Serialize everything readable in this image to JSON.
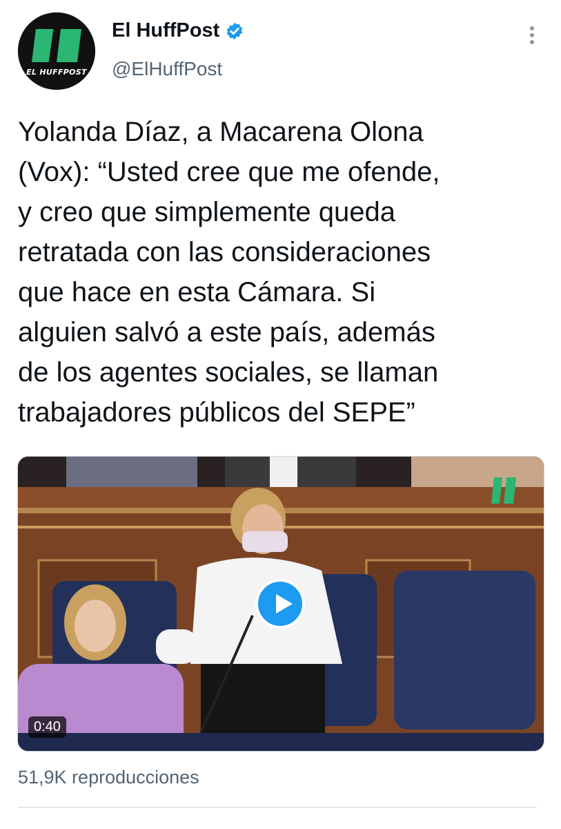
{
  "account": {
    "display_name": "El HuffPost",
    "handle": "@ElHuffPost",
    "avatar_text": "EL HUFFPOST",
    "verified": true,
    "brand_color": "#2bb673",
    "verified_color": "#1d9bf0"
  },
  "tweet": {
    "text": "Yolanda Díaz, a Macarena Olona\n(Vox): “Usted cree que me ofende,\ny creo que simplemente queda\nretratada con las consideraciones\nque hace en esta Cámara. Si\nalguien salvó a este país, además\nde los agentes sociales, se llaman\ntrabajadores públicos del SEPE”"
  },
  "media": {
    "type": "video",
    "duration": "0:40",
    "views": "51,9K reproducciones"
  },
  "icons": {
    "more": "more-vertical-icon",
    "play": "play-icon",
    "verified": "verified-badge-icon"
  }
}
